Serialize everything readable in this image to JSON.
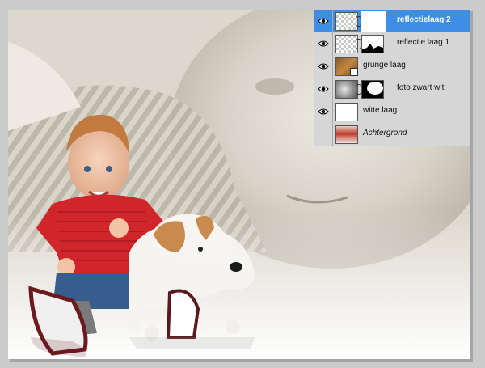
{
  "layers_panel": {
    "layers": [
      {
        "name": "reflectielaag 2",
        "visible": true,
        "selected": true,
        "thumb": "transparent",
        "has_mask": true
      },
      {
        "name": "reflectie laag 1",
        "visible": true,
        "selected": false,
        "thumb": "transparent",
        "has_mask": true
      },
      {
        "name": "grunge laag",
        "visible": true,
        "selected": false,
        "thumb": "grunge",
        "has_mask": false
      },
      {
        "name": "foto zwart wit",
        "visible": true,
        "selected": false,
        "thumb": "photo",
        "has_mask": true
      },
      {
        "name": "witte laag",
        "visible": true,
        "selected": false,
        "thumb": "white",
        "has_mask": false
      },
      {
        "name": "Achtergrond",
        "visible": false,
        "selected": false,
        "thumb": "achtergrond",
        "has_mask": false
      }
    ]
  },
  "colors": {
    "selection": "#3d8ee4",
    "panel": "#d6d6d6",
    "workspace": "#cbcbcb"
  },
  "icons": [
    "eye-icon",
    "link-chain-icon",
    "smart-object-icon"
  ]
}
